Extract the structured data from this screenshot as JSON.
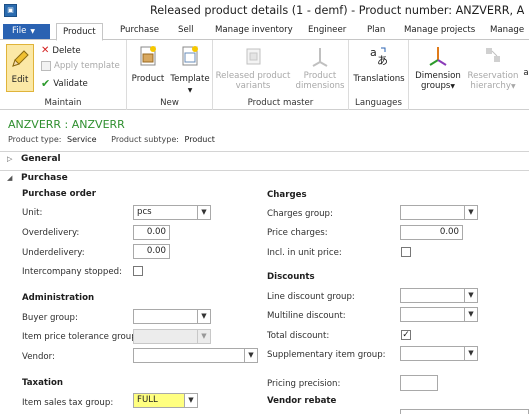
{
  "window": {
    "title": "Released product details (1 - demf) - Product number: ANZVERR, A"
  },
  "tabs": {
    "file": "File",
    "items": [
      "Product",
      "Purchase",
      "Sell",
      "Manage inventory",
      "Engineer",
      "Plan",
      "Manage projects",
      "Manage"
    ]
  },
  "ribbon": {
    "maintain": {
      "label": "Maintain",
      "edit": "Edit",
      "delete": "Delete",
      "apply_template": "Apply template",
      "validate": "Validate"
    },
    "new": {
      "label": "New",
      "product": "Product",
      "template": "Template"
    },
    "product_master": {
      "label": "Product master",
      "released_variants": "Released product variants",
      "released_variants_l1": "Released product",
      "released_variants_l2": "variants",
      "dimensions_l1": "Product",
      "dimensions_l2": "dimensions"
    },
    "languages": {
      "label": "Languages",
      "translations": "Translations"
    },
    "dimension_groups_l1": "Dimension",
    "dimension_groups_l2": "groups",
    "reservation_l1": "Reservation",
    "reservation_l2": "hierarchy"
  },
  "record": {
    "title": "ANZVERR : ANZVERR",
    "product_type_label": "Product type:",
    "product_type": "Service",
    "product_subtype_label": "Product subtype:",
    "product_subtype": "Product"
  },
  "fasttabs": {
    "general": "General",
    "purchase": "Purchase"
  },
  "purchase_order": {
    "header": "Purchase order",
    "unit_label": "Unit:",
    "unit": "pcs",
    "overdelivery_label": "Overdelivery:",
    "overdelivery": "0.00",
    "underdelivery_label": "Underdelivery:",
    "underdelivery": "0.00",
    "intercompany_label": "Intercompany stopped:",
    "intercompany_checked": false
  },
  "administration": {
    "header": "Administration",
    "buyer_group_label": "Buyer group:",
    "buyer_group": "",
    "tolerance_label": "Item price tolerance group:",
    "tolerance": "",
    "vendor_label": "Vendor:",
    "vendor": ""
  },
  "taxation": {
    "header": "Taxation",
    "sales_tax_label": "Item sales tax group:",
    "sales_tax": "FULL"
  },
  "charges": {
    "header": "Charges",
    "charges_group_label": "Charges group:",
    "charges_group": "",
    "price_charges_label": "Price charges:",
    "price_charges": "0.00",
    "incl_unit_price_label": "Incl. in unit price:",
    "incl_unit_price_checked": false
  },
  "discounts": {
    "header": "Discounts",
    "line_discount_label": "Line discount group:",
    "line_discount": "",
    "multiline_label": "Multiline discount:",
    "multiline": "",
    "total_discount_label": "Total discount:",
    "total_discount_checked": true,
    "supplementary_label": "Supplementary item group:",
    "supplementary": ""
  },
  "pricing_precision_label": "Pricing precision:",
  "pricing_precision": "",
  "vendor_rebate_header": "Vendor rebate",
  "colors": {
    "file_tab": "#2a62b2",
    "title_green": "#2f8f2f",
    "highlight": "#ffff80"
  }
}
